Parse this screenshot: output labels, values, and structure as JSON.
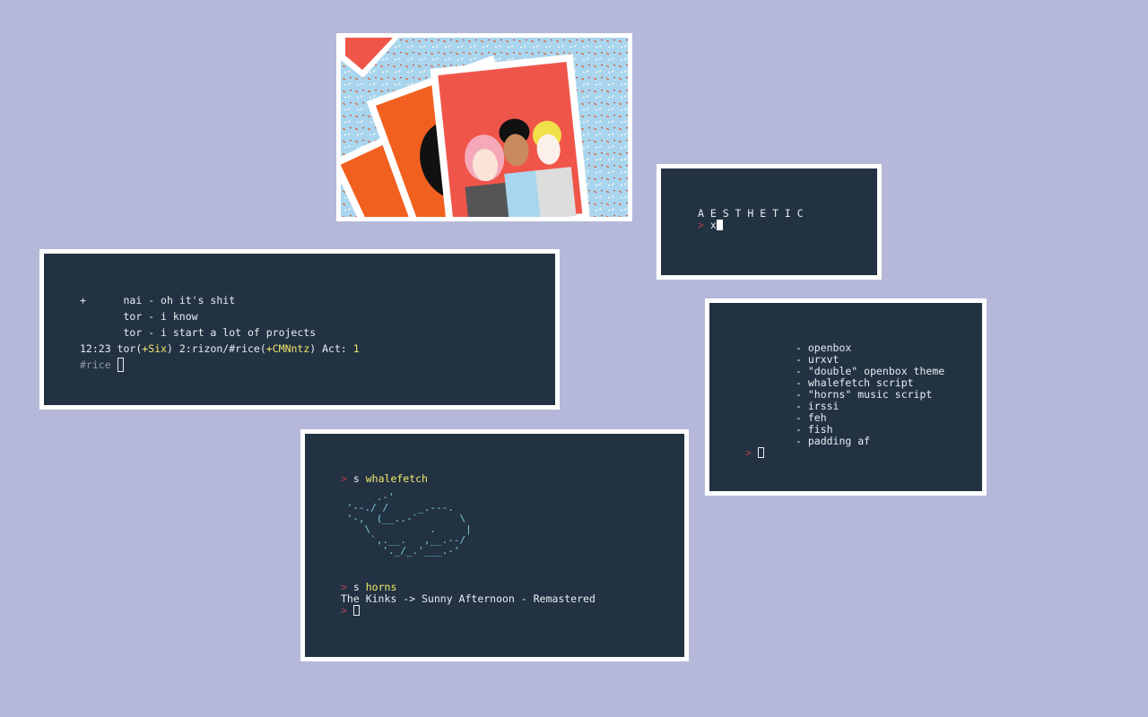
{
  "colors": {
    "desktop": "#b5b8d8",
    "terminal_bg": "#223243",
    "frame": "#ffffff",
    "prompt": "#b4404a",
    "highlight": "#f1e76a",
    "whale": "#7ccdcc"
  },
  "aesthetic_window": {
    "title": "A E S T H E T I C",
    "prompt_symbol": ">",
    "input": "x"
  },
  "irc_window": {
    "messages": [
      {
        "marker": "+",
        "nick": "nai",
        "text": "oh it's shit"
      },
      {
        "marker": "",
        "nick": "tor",
        "text": "i know"
      },
      {
        "marker": "",
        "nick": "tor",
        "text": "i start a lot of projects"
      }
    ],
    "status": {
      "time": "12:23",
      "nick": "tor",
      "mode": "+Six",
      "window": "2:rizon/#rice",
      "chanmode": "+CMNntz",
      "act_label": "Act:",
      "act_value": "1"
    },
    "input_channel": "#rice"
  },
  "list_window": {
    "items": [
      "- openbox",
      "- urxvt",
      "- \"double\" openbox theme",
      "- whalefetch script",
      "- \"horns\" music script",
      "- irssi",
      "- feh",
      "- fish",
      "- padding af"
    ],
    "prompt_symbol": ">"
  },
  "main_window": {
    "prompt_symbol": ">",
    "cmd1_prefix": "s",
    "cmd1": "whalefetch",
    "whale_art": "      .-'\n '--./ /     _.---.\n '-,  (__..-`       \\\n    \\          .     |\n     `,.__.   ,__.--/\n       '._/_.'___.-'",
    "cmd2_prefix": "s",
    "cmd2": "horns",
    "now_playing": "The Kinks -> Sunny Afternoon - Remastered"
  },
  "artwork": {
    "description_icon": "polaroid-illustration-icon"
  }
}
